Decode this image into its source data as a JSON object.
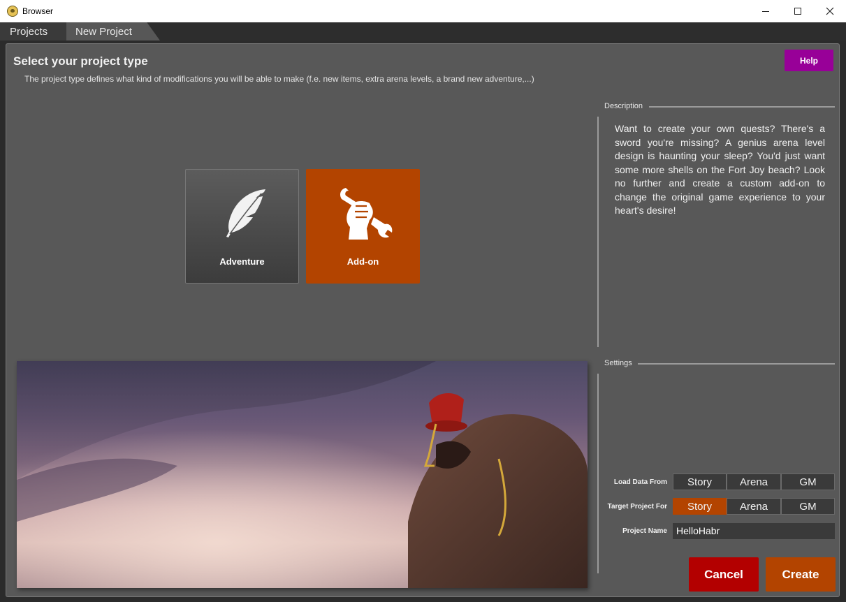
{
  "window": {
    "title": "Browser",
    "icon": "app-icon",
    "controls": [
      "minimize-icon",
      "maximize-icon",
      "close-icon"
    ]
  },
  "tabs": [
    {
      "label": "Projects",
      "active": false
    },
    {
      "label": "New Project",
      "active": true
    }
  ],
  "header": {
    "title": "Select your project type",
    "subtitle": "The project type defines what kind of modifications you will be able to make (f.e. new items, extra arena levels, a brand new adventure,...)",
    "help_label": "Help"
  },
  "project_types": [
    {
      "label": "Adventure",
      "icon": "feather-icon",
      "selected": false
    },
    {
      "label": "Add-on",
      "icon": "wrench-fist-icon",
      "selected": true
    }
  ],
  "description": {
    "label": "Description",
    "text": "Want to create your own quests? There's a sword you're missing? A genius arena level design is haunting your sleep? You'd just want some more shells on the Fort Joy beach? Look no further and create a custom add-on to change the original game experience to your heart's desire!"
  },
  "settings": {
    "label": "Settings",
    "load_data_from": {
      "label": "Load Data From",
      "options": [
        "Story",
        "Arena",
        "GM"
      ],
      "selected": null
    },
    "target_project_for": {
      "label": "Target Project For",
      "options": [
        "Story",
        "Arena",
        "GM"
      ],
      "selected": "Story"
    },
    "project_name": {
      "label": "Project Name",
      "value": "HelloHabr"
    }
  },
  "actions": {
    "cancel_label": "Cancel",
    "create_label": "Create"
  },
  "colors": {
    "accent_orange": "#b34400",
    "help_purple": "#980098",
    "cancel_red": "#b30000",
    "panel_gray": "#585858"
  }
}
